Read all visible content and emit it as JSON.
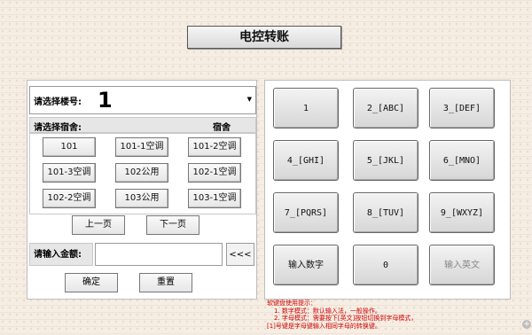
{
  "title": "电控转账",
  "floor": {
    "label": "请选择楼号:",
    "value": "1"
  },
  "dorm": {
    "label": "请选择宿舍:",
    "value": "宿舍"
  },
  "rooms": [
    "101",
    "101-1空调",
    "101-2空调",
    "101-3空调",
    "102公用",
    "102-1空调",
    "102-2空调",
    "103公用",
    "103-1空调"
  ],
  "nav": {
    "prev": "上一页",
    "next": "下一页"
  },
  "amount": {
    "label": "请输入金额:",
    "value": "",
    "backspace": "<<<"
  },
  "actions": {
    "confirm": "确定",
    "reset": "重置"
  },
  "keypad": [
    "1",
    "2_[ABC]",
    "3_[DEF]",
    "4_[GHI]",
    "5_[JKL]",
    "6_[MNO]",
    "7_[PQRS]",
    "8_[TUV]",
    "9_[WXYZ]",
    "输入数字",
    "0",
    "输入英文"
  ],
  "hint_lines": [
    "软键盘使用提示：",
    "1. 数字模式：默认输入法，一般操作。",
    "2. 字母模式：需要按下[英文]按钮切换到字母模式，",
    "[1]号键是字母键输入相同字母的转换键。"
  ],
  "corner_icon": "plus-circle-icon"
}
